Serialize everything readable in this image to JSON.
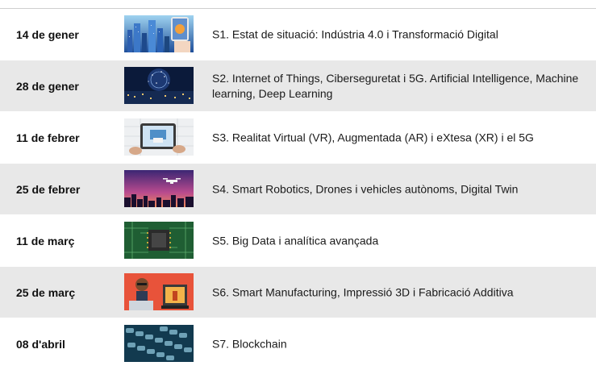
{
  "sessions": [
    {
      "date": "14 de gener",
      "title": "S1. Estat de situació: Indústria 4.0 i Transformació Digital",
      "image": "city-skyline-tablet-image"
    },
    {
      "date": "28 de gener",
      "title": "S2. Internet of Things, Ciberseguretat i 5G. Artificial Intelligence, Machine learning, Deep Learning",
      "image": "network-globe-image"
    },
    {
      "date": "11 de febrer",
      "title": "S3. Realitat Virtual (VR), Augmentada (AR) i eXtesa (XR) i el 5G",
      "image": "tablet-augmented-reality-image"
    },
    {
      "date": "25 de febrer",
      "title": "S4. Smart Robotics, Drones i vehicles autònoms, Digital Twin",
      "image": "drone-sunset-image"
    },
    {
      "date": "11 de març",
      "title": "S5. Big Data i analítica avançada",
      "image": "circuit-chip-image"
    },
    {
      "date": "25 de març",
      "title": "S6. Smart Manufacturing, Impressió 3D i Fabricació Additiva",
      "image": "3d-printer-image"
    },
    {
      "date": "08 d'abril",
      "title": "S7. Blockchain",
      "image": "blockchain-chain-image"
    }
  ]
}
